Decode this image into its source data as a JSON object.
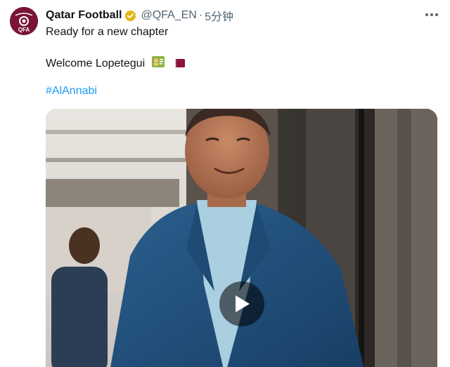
{
  "account": {
    "display_name": "Qatar Football",
    "handle": "@QFA_EN",
    "separator": "·",
    "timestamp": "5分钟",
    "avatar_icon": "qfa-crest-icon",
    "verified_icon": "verified-gold-badge-icon"
  },
  "tweet": {
    "line1": "Ready for a new chapter",
    "line2": "Welcome Lopetegui",
    "line2_emojis": [
      "person-card-emoji",
      "qatar-flag-emoji"
    ],
    "hashtag": "#AlAnnabi"
  },
  "media": {
    "type": "video",
    "play_icon": "play-icon"
  },
  "colors": {
    "text": "#0f1419",
    "muted": "#536471",
    "link": "#1d9bf0",
    "verified": "#e2b719",
    "brand": "#7a1434"
  }
}
